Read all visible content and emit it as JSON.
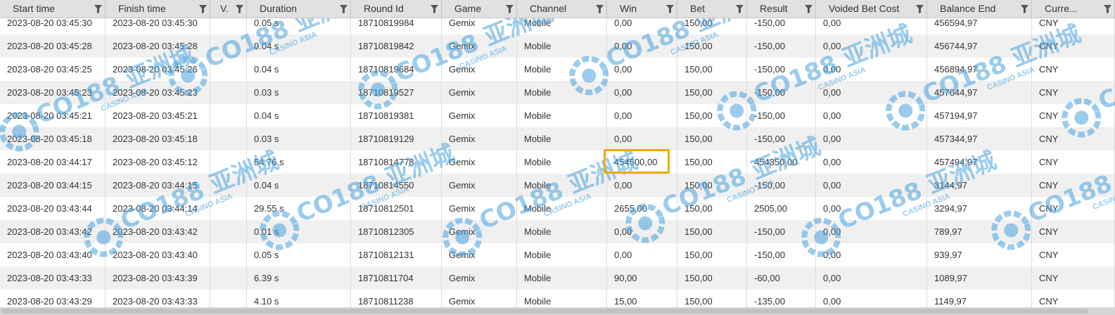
{
  "columns": [
    {
      "key": "start",
      "label": "Start time"
    },
    {
      "key": "finish",
      "label": "Finish time"
    },
    {
      "key": "v",
      "label": "V."
    },
    {
      "key": "duration",
      "label": "Duration"
    },
    {
      "key": "round",
      "label": "Round Id"
    },
    {
      "key": "game",
      "label": "Game"
    },
    {
      "key": "channel",
      "label": "Channel"
    },
    {
      "key": "win",
      "label": "Win"
    },
    {
      "key": "bet",
      "label": "Bet"
    },
    {
      "key": "result",
      "label": "Result"
    },
    {
      "key": "voided",
      "label": "Voided Bet Cost"
    },
    {
      "key": "balance",
      "label": "Balance End"
    },
    {
      "key": "currency",
      "label": "Curre..."
    }
  ],
  "rows": [
    [
      "2023-08-20 03:45:30",
      "2023-08-20 03:45:30",
      "",
      "0.05 s",
      "18710819984",
      "Gemix",
      "Mobile",
      "0,00",
      "150,00",
      "-150,00",
      "0,00",
      "456594,97",
      "CNY"
    ],
    [
      "2023-08-20 03:45:28",
      "2023-08-20 03:45:28",
      "",
      "0.04 s",
      "18710819842",
      "Gemix",
      "Mobile",
      "0,00",
      "150,00",
      "-150,00",
      "0,00",
      "456744,97",
      "CNY"
    ],
    [
      "2023-08-20 03:45:25",
      "2023-08-20 03:45:26",
      "",
      "0.04 s",
      "18710819684",
      "Gemix",
      "Mobile",
      "0,00",
      "150,00",
      "-150,00",
      "0,00",
      "456894,97",
      "CNY"
    ],
    [
      "2023-08-20 03:45:23",
      "2023-08-20 03:45:23",
      "",
      "0.03 s",
      "18710819527",
      "Gemix",
      "Mobile",
      "0,00",
      "150,00",
      "-150,00",
      "0,00",
      "457044,97",
      "CNY"
    ],
    [
      "2023-08-20 03:45:21",
      "2023-08-20 03:45:21",
      "",
      "0.04 s",
      "18710819381",
      "Gemix",
      "Mobile",
      "0,00",
      "150,00",
      "-150,00",
      "0,00",
      "457194,97",
      "CNY"
    ],
    [
      "2023-08-20 03:45:18",
      "2023-08-20 03:45:18",
      "",
      "0.03 s",
      "18710819129",
      "Gemix",
      "Mobile",
      "0,00",
      "150,00",
      "-150,00",
      "0,00",
      "457344,97",
      "CNY"
    ],
    [
      "2023-08-20 03:44:17",
      "2023-08-20 03:45:12",
      "",
      "54.76 s",
      "18710814778",
      "Gemix",
      "Mobile",
      "454500,00",
      "150,00",
      "454350,00",
      "0,00",
      "457494,97",
      "CNY"
    ],
    [
      "2023-08-20 03:44:15",
      "2023-08-20 03:44:15",
      "",
      "0.04 s",
      "18710814550",
      "Gemix",
      "Mobile",
      "0,00",
      "150,00",
      "-150,00",
      "0,00",
      "3144,97",
      "CNY"
    ],
    [
      "2023-08-20 03:43:44",
      "2023-08-20 03:44:14",
      "",
      "29.55 s",
      "18710812501",
      "Gemix",
      "Mobile",
      "2655,00",
      "150,00",
      "2505,00",
      "0,00",
      "3294,97",
      "CNY"
    ],
    [
      "2023-08-20 03:43:42",
      "2023-08-20 03:43:42",
      "",
      "0.01 s",
      "18710812305",
      "Gemix",
      "Mobile",
      "0,00",
      "150,00",
      "-150,00",
      "0,00",
      "789,97",
      "CNY"
    ],
    [
      "2023-08-20 03:43:40",
      "2023-08-20 03:43:40",
      "",
      "0.05 s",
      "18710812131",
      "Gemix",
      "Mobile",
      "0,00",
      "150,00",
      "-150,00",
      "0,00",
      "939,97",
      "CNY"
    ],
    [
      "2023-08-20 03:43:33",
      "2023-08-20 03:43:39",
      "",
      "6.39 s",
      "18710811704",
      "Gemix",
      "Mobile",
      "90,00",
      "150,00",
      "-60,00",
      "0,00",
      "1089,97",
      "CNY"
    ],
    [
      "2023-08-20 03:43:29",
      "2023-08-20 03:43:33",
      "",
      "4.10 s",
      "18710811238",
      "Gemix",
      "Mobile",
      "15,00",
      "150,00",
      "-135,00",
      "0,00",
      "1149,97",
      "CNY"
    ]
  ],
  "watermark": {
    "brand": "CO188",
    "cn": "亚洲城",
    "en": "CASINO ASIA",
    "color": "#4aa3df"
  },
  "highlight_color": "#f0a800",
  "icons": {
    "filter": "funnel-filter-icon"
  }
}
